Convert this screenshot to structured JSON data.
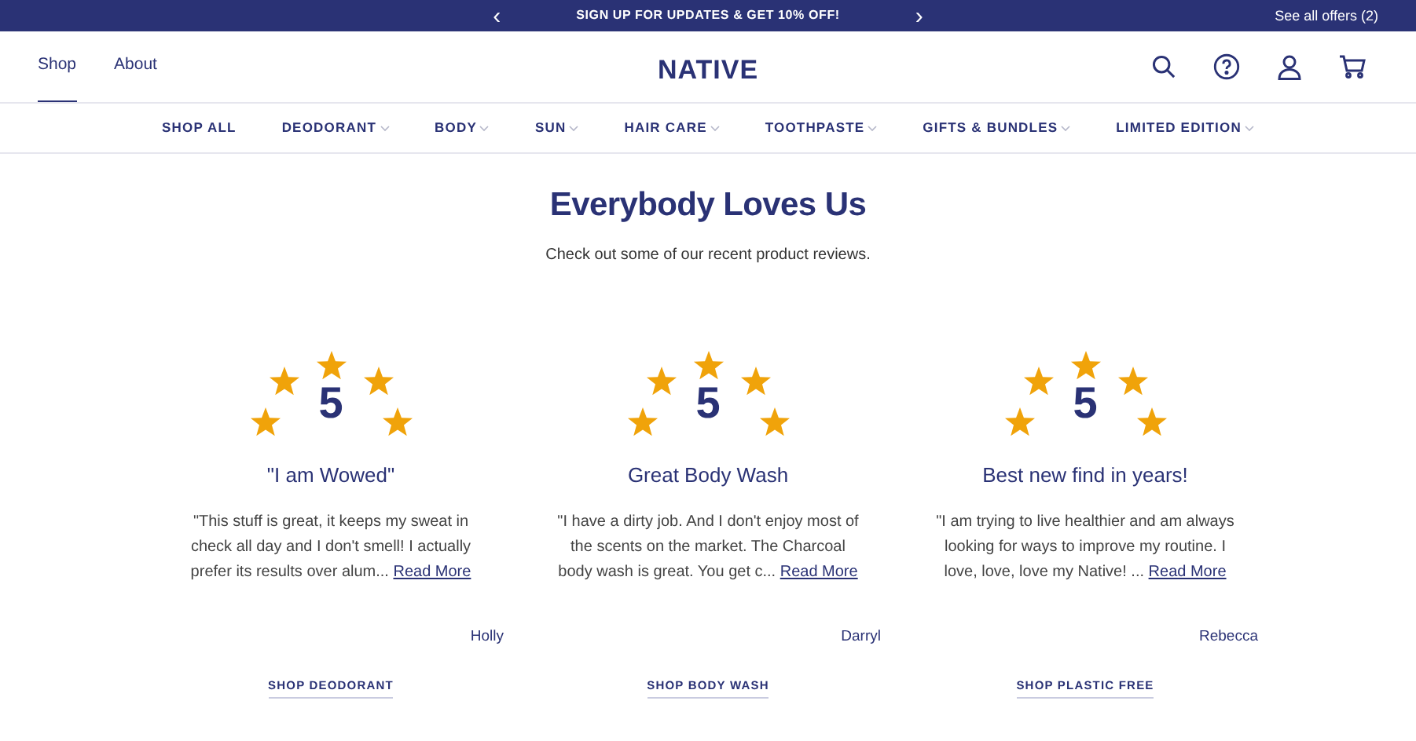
{
  "promo_bar": {
    "prev": "‹",
    "message": "SIGN UP FOR UPDATES & GET 10% OFF!",
    "next": "›",
    "offers_link": "See all offers (2)"
  },
  "header": {
    "links": [
      {
        "label": "Shop",
        "selected": true
      },
      {
        "label": "About",
        "selected": false
      }
    ],
    "logo": "NATIVE"
  },
  "nav": [
    {
      "label": "SHOP ALL",
      "has_menu": false
    },
    {
      "label": "DEODORANT",
      "has_menu": true
    },
    {
      "label": "BODY",
      "has_menu": true
    },
    {
      "label": "SUN",
      "has_menu": true
    },
    {
      "label": "HAIR CARE",
      "has_menu": true
    },
    {
      "label": "TOOTHPASTE",
      "has_menu": true
    },
    {
      "label": "GIFTS & BUNDLES",
      "has_menu": true
    },
    {
      "label": "LIMITED EDITION",
      "has_menu": true
    }
  ],
  "section": {
    "title": "Everybody Loves Us",
    "subtitle": "Check out some of our recent product reviews."
  },
  "reviews": [
    {
      "score": "5",
      "title": "\"I am Wowed\"",
      "text": "\"This stuff is great, it keeps my sweat in check all day and I don't smell! I actually prefer its results over alum...",
      "link": "Read More",
      "author": "Holly",
      "shop_link": "SHOP DEODORANT"
    },
    {
      "score": "5",
      "title": "Great Body Wash",
      "text": "\"I have a dirty job. And I don't enjoy most of the scents on the market. The Charcoal body wash is great. You get c...",
      "link": "Read More",
      "author": "Darryl",
      "shop_link": "SHOP BODY WASH"
    },
    {
      "score": "5",
      "title": "Best new find in years!",
      "text": "\"I am trying to live healthier and am always looking for ways to improve my routine. I love, love, love my Native! ...",
      "link": "Read More",
      "author": "Rebecca",
      "shop_link": "SHOP PLASTIC FREE"
    }
  ]
}
